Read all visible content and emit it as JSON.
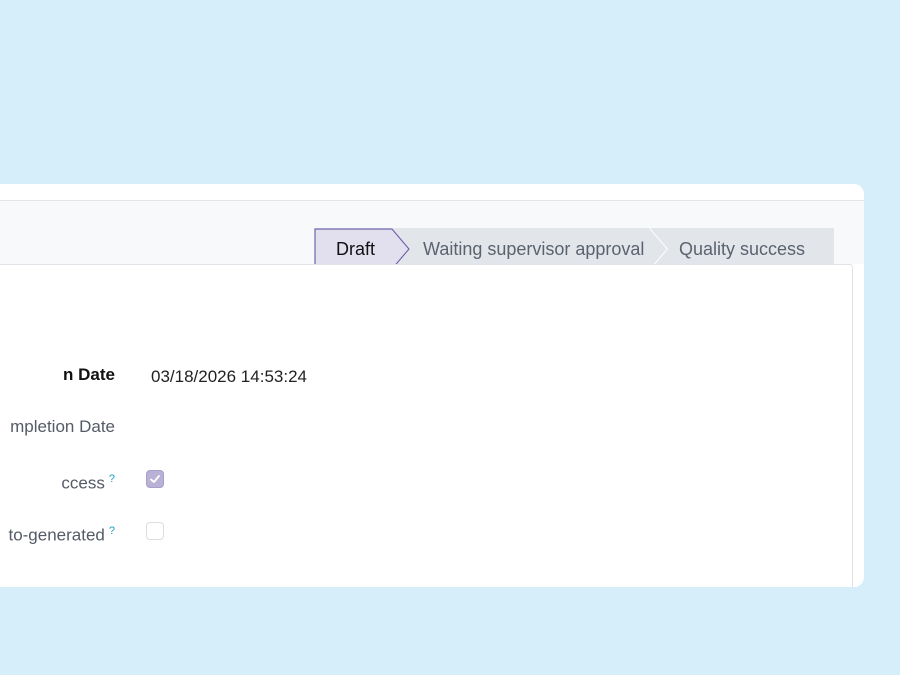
{
  "statusbar": {
    "stages": [
      {
        "label": "Draft",
        "active": true
      },
      {
        "label": "Waiting supervisor approval",
        "active": false
      },
      {
        "label": "Quality success",
        "active": false
      }
    ]
  },
  "form": {
    "fields": [
      {
        "label": "n Date",
        "value": "03/18/2026 14:53:24",
        "bold": true
      },
      {
        "label": "mpletion Date",
        "value": ""
      },
      {
        "label": "ccess",
        "help": "?",
        "checked": true
      },
      {
        "label": "to-generated",
        "help": "?",
        "checked": false
      }
    ]
  },
  "colors": {
    "background": "#d6eefa",
    "active_stage": "#e2e0ef",
    "active_stage_border": "#6f63a8",
    "inactive_stage": "#e2e6ea",
    "checkbox_checked": "#b9b1d6",
    "help_mark": "#1aa0b9"
  }
}
